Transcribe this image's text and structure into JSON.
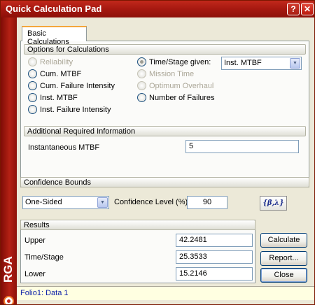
{
  "window": {
    "title": "Quick Calculation Pad",
    "help_glyph": "?",
    "close_glyph": "✕"
  },
  "sidebar": {
    "brand": "RGA"
  },
  "tabs": [
    {
      "label": "Basic Calculations"
    }
  ],
  "options": {
    "heading": "Options for Calculations",
    "left": [
      {
        "label": "Reliability",
        "state": "disabled"
      },
      {
        "label": "Cum. MTBF",
        "state": "enabled"
      },
      {
        "label": "Cum. Failure Intensity",
        "state": "enabled"
      },
      {
        "label": "Inst. MTBF",
        "state": "enabled"
      },
      {
        "label": "Inst. Failure Intensity",
        "state": "enabled"
      }
    ],
    "right": [
      {
        "label": "Time/Stage given:",
        "state": "checked"
      },
      {
        "label": "Mission Time",
        "state": "disabled"
      },
      {
        "label": "Optimum Overhaul",
        "state": "disabled"
      },
      {
        "label": "Number of Failures",
        "state": "enabled"
      }
    ],
    "dropdown_value": "Inst. MTBF",
    "dropdown_arrow": "▼"
  },
  "additional": {
    "heading": "Additional Required Information",
    "field_label": "Instantaneous MTBF",
    "field_value": "5"
  },
  "confidence": {
    "heading": "Confidence Bounds",
    "type_value": "One-Sided",
    "type_arrow": "▼",
    "level_label": "Confidence Level (%)",
    "level_value": "90",
    "param_button": "{β,λ}"
  },
  "results": {
    "heading": "Results",
    "rows": [
      {
        "label": "Upper",
        "value": "42.2481"
      },
      {
        "label": "Time/Stage",
        "value": "25.3533"
      },
      {
        "label": "Lower",
        "value": "15.2146"
      }
    ]
  },
  "buttons": {
    "calculate": "Calculate",
    "report": "Report...",
    "close": "Close"
  },
  "status": {
    "text": "Folio1: Data 1"
  }
}
